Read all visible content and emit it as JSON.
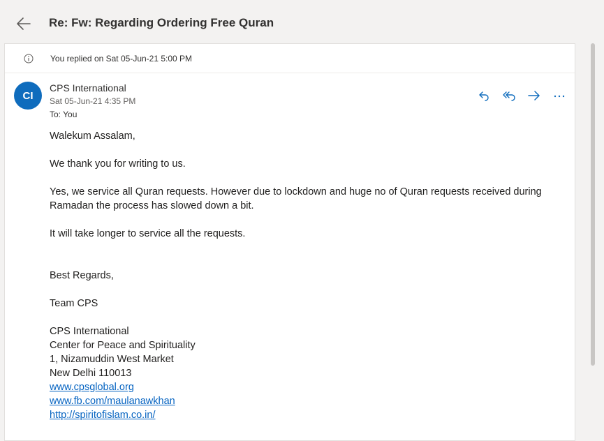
{
  "header": {
    "back_icon": "arrow-left-icon",
    "subject": "Re: Fw: Regarding Ordering Free Quran"
  },
  "info_bar": {
    "icon": "info-icon",
    "text": "You replied on Sat 05-Jun-21 5:00 PM"
  },
  "message": {
    "avatar_initials": "CI",
    "avatar_color": "#0f6cbd",
    "sender": "CPS International",
    "date": "Sat 05-Jun-21 4:35 PM",
    "to_line": "To:  You",
    "actions": [
      {
        "name": "reply",
        "icon": "reply-icon"
      },
      {
        "name": "reply-all",
        "icon": "reply-all-icon"
      },
      {
        "name": "forward",
        "icon": "forward-icon"
      },
      {
        "name": "more",
        "icon": "more-icon"
      }
    ],
    "accent_color": "#0f6cbd"
  },
  "body": {
    "greeting": "Walekum Assalam,",
    "para1": "We thank you for writing to us.",
    "para2": "Yes, we service all Quran requests. However due to lockdown and huge no of Quran requests received during Ramadan the process has slowed down a bit.",
    "para3": "It will take longer to service all the requests.",
    "closing": "Best Regards,",
    "team": "Team CPS",
    "signature": {
      "org": "CPS International",
      "center": "Center for Peace and Spirituality",
      "address": "1, Nizamuddin West Market",
      "city": "New Delhi 110013",
      "links": [
        "www.cpsglobal.org",
        "www.fb.com/maulanawkhan",
        "http://spiritofislam.co.in/"
      ]
    }
  }
}
